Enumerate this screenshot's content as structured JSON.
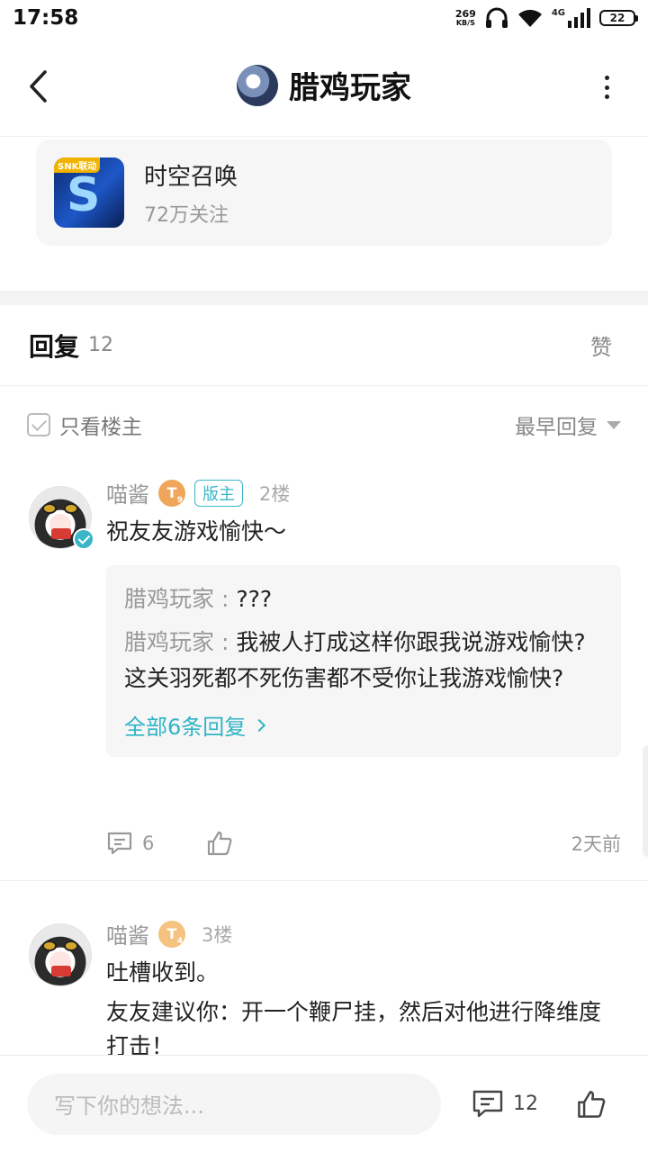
{
  "status": {
    "time": "17:58",
    "net_speed": "269",
    "net_unit": "KB/S",
    "network": "4G",
    "battery": "22"
  },
  "header": {
    "title": "腊鸡玩家"
  },
  "game": {
    "name": "时空召唤",
    "followers": "72万关注",
    "icon_tag": "SNK联动"
  },
  "replies": {
    "title": "回复",
    "count": "12",
    "like_tab": "赞"
  },
  "filter": {
    "only_op": "只看楼主",
    "sort": "最早回复"
  },
  "comments": [
    {
      "user": "喵酱",
      "level": "T",
      "level_num": "9",
      "badge": "版主",
      "floor": "2楼",
      "text": "祝友友游戏愉快～",
      "quotes": [
        {
          "name": "腊鸡玩家",
          "sep": " : ",
          "text": "???"
        },
        {
          "name": "腊鸡玩家",
          "sep": " : ",
          "text": "我被人打成这样你跟我说游戏愉快?这关羽死都不死伤害都不受你让我游戏愉快?"
        }
      ],
      "all_replies": "全部6条回复",
      "reply_count": "6",
      "time_ago": "2天前"
    },
    {
      "user": "喵酱",
      "level": "T",
      "level_num": "4",
      "floor": "3楼",
      "line1": "吐槽收到。",
      "line2": "友友建议你：开一个鞭尸挂，然后对他进行降维度打击！"
    }
  ],
  "bottom": {
    "placeholder": "写下你的想法...",
    "comment_count": "12"
  }
}
